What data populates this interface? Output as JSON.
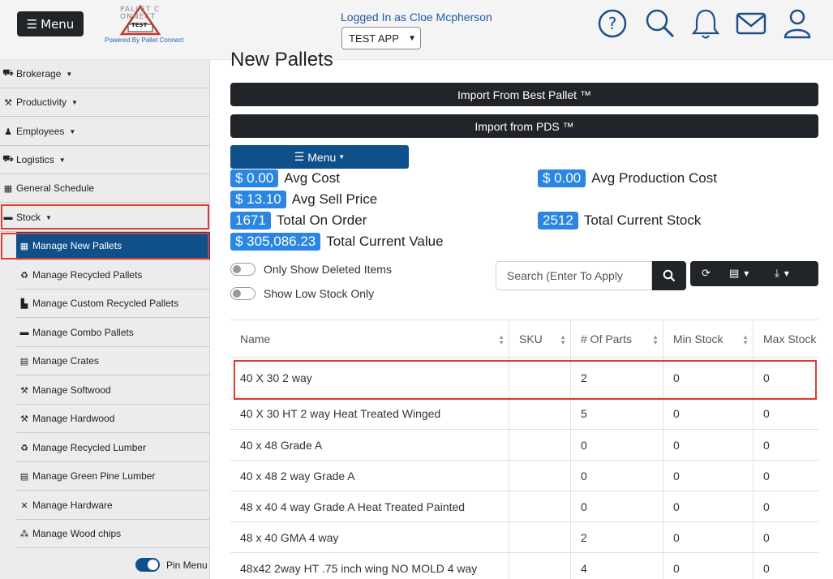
{
  "header": {
    "menu_label": "Menu",
    "logo_text": "PALLET CONNECT",
    "logo_badge": "TEST",
    "powered_by": "Powered By Pallet Connect",
    "logged_in": "Logged In as Cloe Mcpherson",
    "app_select": "TEST APP",
    "icons": [
      "help-icon",
      "search-icon",
      "bell-icon",
      "mail-icon",
      "user-icon"
    ]
  },
  "sidebar": {
    "items": [
      {
        "label": "Brokerage",
        "icon": "truck-icon"
      },
      {
        "label": "Productivity",
        "icon": "hammer-icon"
      },
      {
        "label": "Employees",
        "icon": "person-icon"
      },
      {
        "label": "Logistics",
        "icon": "truck-icon"
      },
      {
        "label": "General Schedule",
        "icon": "calendar-icon"
      },
      {
        "label": "Stock",
        "icon": "pallet-icon"
      }
    ],
    "sub_items": [
      {
        "label": "Manage New Pallets",
        "icon": "pallet-icon"
      },
      {
        "label": "Manage Recycled Pallets",
        "icon": "recycle-icon"
      },
      {
        "label": "Manage Custom Recycled Pallets",
        "icon": "stair-icon"
      },
      {
        "label": "Manage Combo Pallets",
        "icon": "pallet-icon"
      },
      {
        "label": "Manage Crates",
        "icon": "crate-icon"
      },
      {
        "label": "Manage Softwood",
        "icon": "hammer-icon"
      },
      {
        "label": "Manage Hardwood",
        "icon": "hammer-icon"
      },
      {
        "label": "Manage Recycled Lumber",
        "icon": "recycle-icon"
      },
      {
        "label": "Manage Green Pine Lumber",
        "icon": "crate-icon"
      },
      {
        "label": "Manage Hardware",
        "icon": "tools-icon"
      },
      {
        "label": "Manage Wood chips",
        "icon": "chips-icon"
      }
    ],
    "pin_menu": "Pin Menu"
  },
  "main": {
    "title": "New Pallets",
    "import_best": "Import From Best Pallet ™",
    "import_pds": "Import from PDS ™",
    "menu_label": "Menu",
    "stats": {
      "avg_cost_value": "$ 0.00",
      "avg_cost_label": "Avg Cost",
      "avg_prod_value": "$ 0.00",
      "avg_prod_label": "Avg Production Cost",
      "avg_sell_value": "$ 13.10",
      "avg_sell_label": "Avg Sell Price",
      "on_order_value": "1671",
      "on_order_label": "Total On Order",
      "cur_stock_value": "2512",
      "cur_stock_label": "Total Current Stock",
      "cur_value_value": "$ 305,086.23",
      "cur_value_label": "Total Current Value"
    },
    "toggle_deleted": "Only Show Deleted Items",
    "toggle_low": "Show Low Stock Only",
    "search_placeholder": "Search (Enter To Apply"
  },
  "table": {
    "headers": [
      "Name",
      "SKU",
      "# Of Parts",
      "Min Stock",
      "Max Stock"
    ],
    "rows": [
      [
        "40 X 30 2 way",
        "",
        "2",
        "0",
        "0"
      ],
      [
        "40 X 30 HT 2 way Heat Treated Winged",
        "",
        "5",
        "0",
        "0"
      ],
      [
        "40 x 48 Grade A",
        "",
        "0",
        "0",
        "0"
      ],
      [
        "40 x 48 2 way Grade A",
        "",
        "0",
        "0",
        "0"
      ],
      [
        "48 x 40 4 way Grade A Heat Treated Painted",
        "",
        "0",
        "0",
        "0"
      ],
      [
        "48 x 40 GMA 4 way",
        "",
        "2",
        "0",
        "0"
      ],
      [
        "48x42 2way HT .75 inch wing NO MOLD 4 way",
        "",
        "4",
        "0",
        "0"
      ]
    ]
  }
}
